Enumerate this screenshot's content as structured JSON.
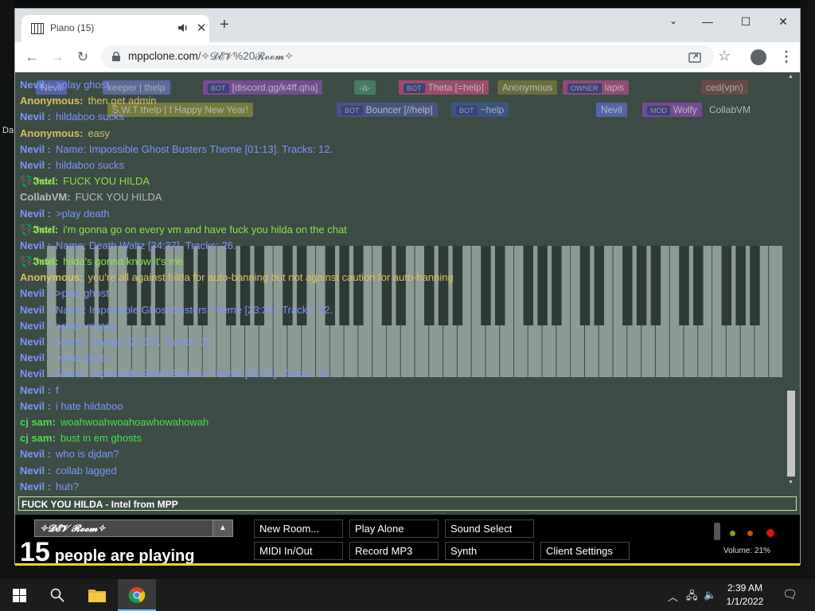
{
  "desktop": {
    "left_fragment": "Da"
  },
  "browser": {
    "tab_title": "Piano (15)",
    "url_host": "mppclone.com",
    "url_path": "/✧𝓓𝓔𝓥%20𝓡𝓸𝓸𝓶✧"
  },
  "name_tags": [
    {
      "text": "Nevil",
      "bg": "#5b6dcf",
      "fg": "#ddd"
    },
    {
      "text": "keeper | thelp",
      "bg": "#6674b8",
      "fg": "#ccc"
    },
    {
      "text": "[discord.gg/k4ff.qha]",
      "bg": "#8a4bb0",
      "fg": "#ddd",
      "bot": "BOT"
    },
    {
      "text": "-a-",
      "bg": "#4a8a70",
      "fg": "#ccc"
    },
    {
      "text": "Theta [=help]",
      "bg": "#c04a7a",
      "fg": "#ddd",
      "bot": "BOT"
    },
    {
      "text": "Anonymous",
      "bg": "#7a7a3a",
      "fg": "#ddd"
    },
    {
      "text": "lapis",
      "bg": "#b04a8a",
      "fg": "#ddd",
      "bot": "OWNER"
    },
    {
      "text": "ced(vpn)",
      "bg": "#7a4a4a",
      "fg": "#ccc"
    },
    {
      "text": "S.W.T thelp | f  Happy New Year!",
      "bg": "#8a8a3a",
      "fg": "#ddd"
    },
    {
      "text": "Bouncer [//help]",
      "bg": "#4a5a9a",
      "fg": "#ddd",
      "bot": "BOT"
    },
    {
      "text": "~help",
      "bg": "#3a5a9a",
      "fg": "#ccc",
      "bot": "BOT"
    },
    {
      "text": "Nevil",
      "bg": "#5b6dcf",
      "fg": "#ddd"
    },
    {
      "text": "Wolfy",
      "bg": "#8a4ab0",
      "fg": "#ddd",
      "bot": "MOD"
    },
    {
      "text": "CollabVM",
      "bg": "#3c4c45",
      "fg": "#ddd"
    }
  ],
  "chat": [
    {
      "name": "Nevil :",
      "msg": ">play ghost",
      "color": "#7c95ff"
    },
    {
      "name": "Anonymous:",
      "msg": "then get admin",
      "color": "#d9c25a"
    },
    {
      "name": "Nevil :",
      "msg": "hildaboo sucks",
      "color": "#7c95ff"
    },
    {
      "name": "Anonymous:",
      "msg": "easy",
      "color": "#d9c25a"
    },
    {
      "name": "Nevil :",
      "msg": "Name: Impossible Ghost Busters Theme [01:13]. Tracks: 12.",
      "color": "#7c95ff"
    },
    {
      "name": "Nevil :",
      "msg": "hildaboo sucks",
      "color": "#7c95ff"
    },
    {
      "name": "💱𝕴𝖓𝖙𝖊𝖑:",
      "msg": "FUCK YOU HILDA",
      "color": "#8de24a"
    },
    {
      "name": "CollabVM:",
      "msg": "FUCK YOU HILDA",
      "color": "#b9b9b9"
    },
    {
      "name": "Nevil :",
      "msg": ">play death",
      "color": "#7c95ff"
    },
    {
      "name": "💱𝕴𝖓𝖙𝖊𝖑:",
      "msg": "i'm gonna go on every vm and have fuck you hilda on the chat",
      "color": "#8de24a"
    },
    {
      "name": "Nevil :",
      "msg": "Name: Death Waltz [34:37]. Tracks: 26.",
      "color": "#7c95ff"
    },
    {
      "name": "💱𝕴𝖓𝖙𝖊𝖑:",
      "msg": "hilda's gonna know it's me",
      "color": "#8de24a"
    },
    {
      "name": "Anonymous:",
      "msg": "you're all against hilda for auto-banning but not against caution for auto-banning",
      "color": "#d9c25a"
    },
    {
      "name": "Nevil :",
      "msg": ">play ghost",
      "color": "#7c95ff"
    },
    {
      "name": "Nevil :",
      "msg": "Name: Impossible Ghost Busters Theme [23:24]. Tracks: 12.",
      "color": "#7c95ff"
    },
    {
      "name": "Nevil :",
      "msg": ">play voyage",
      "color": "#7c95ff"
    },
    {
      "name": "Nevil :",
      "msg": "Name: Voyage [02:33]. Tracks: 15.",
      "color": "#7c95ff"
    },
    {
      "name": "Nevil :",
      "msg": ">play ghost",
      "color": "#7c95ff"
    },
    {
      "name": "Nevil :",
      "msg": "Name: Impossible Ghost Busters Theme [02:22]. Tracks: 12.",
      "color": "#7c95ff"
    },
    {
      "name": "Nevil :",
      "msg": "f",
      "color": "#7c95ff"
    },
    {
      "name": "Nevil :",
      "msg": "i hate hildaboo",
      "color": "#7c95ff"
    },
    {
      "name": "cj sam:",
      "msg": "woahwoahwoahoawhowahowah",
      "color": "#43e04a"
    },
    {
      "name": "cj sam:",
      "msg": "bust in em ghosts",
      "color": "#43e04a"
    },
    {
      "name": "Nevil :",
      "msg": "who is djdan?",
      "color": "#7c95ff"
    },
    {
      "name": "Nevil :",
      "msg": "collab lagged",
      "color": "#7c95ff"
    },
    {
      "name": "Nevil :",
      "msg": "huh?",
      "color": "#7c95ff"
    }
  ],
  "chat_input": "FUCK YOU HILDA - Intel from MPP",
  "room": {
    "name": "✧𝓓𝓔𝓥 𝓡𝓸𝓸𝓶✧",
    "count": "15",
    "count_text": "people are playing"
  },
  "buttons": {
    "new_room": "New Room...",
    "play_alone": "Play Alone",
    "sound_select": "Sound Select",
    "midi": "MIDI In/Out",
    "record": "Record MP3",
    "synth": "Synth",
    "client_settings": "Client Settings"
  },
  "volume": "Volume: 21%",
  "clock": {
    "time": "2:39 AM",
    "date": "1/1/2022"
  }
}
